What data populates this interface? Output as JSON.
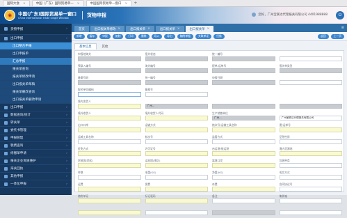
{
  "browser": {
    "tabs": [
      {
        "label": "国际大会",
        "active": false
      },
      {
        "label": "中国（广东）国际贸易单一",
        "active": false
      },
      {
        "label": "中国国际贸易单一窗口",
        "active": true
      }
    ]
  },
  "header": {
    "title": "中国(广东)国际贸易单一窗口",
    "subtitle": "China International Trade Single Window",
    "system_name": "货物申报",
    "user_text": "您好，广州宝联达代理报关有限公司 4401988888",
    "exit_icon": "power-icon"
  },
  "sidebar": {
    "items": [
      {
        "label": "货物申报",
        "level": 0,
        "top": true
      },
      {
        "label": "出口申报",
        "level": 1
      },
      {
        "label": "出口整合申报",
        "level": 2,
        "state": "selected"
      },
      {
        "label": "出口申报单",
        "level": 2
      },
      {
        "label": "汇总申报",
        "level": 2,
        "state": "selected2"
      },
      {
        "label": "报关单查询",
        "level": 2
      },
      {
        "label": "报关单修改申请",
        "level": 2
      },
      {
        "label": "出口报关单草稿",
        "level": 2
      },
      {
        "label": "报关单删改查询",
        "level": 2
      },
      {
        "label": "出口报关单删改申请",
        "level": 2
      },
      {
        "label": "出口申报",
        "level": 1
      },
      {
        "label": "数据查询/统计",
        "level": 1
      },
      {
        "label": "转关单",
        "level": 1
      },
      {
        "label": "委托书管理",
        "level": 1
      },
      {
        "label": "申报管理",
        "level": 1
      },
      {
        "label": "税费查询",
        "level": 1
      },
      {
        "label": "修撤单申请",
        "level": 1
      },
      {
        "label": "报关企业资质维护",
        "level": 1
      },
      {
        "label": "海关回执",
        "level": 1
      },
      {
        "label": "其他申报",
        "level": 1
      },
      {
        "label": "一体化申报",
        "level": 1
      }
    ]
  },
  "main": {
    "tabs": [
      {
        "label": "首页",
        "active": false
      },
      {
        "label": "出口报关单修改",
        "active": false
      },
      {
        "label": "出口报关单",
        "active": false
      },
      {
        "label": "出口报关单",
        "active": false
      },
      {
        "label": "出口报关单",
        "active": true
      }
    ],
    "toolbar": [
      "新增",
      "暂存",
      "申报",
      "复制",
      "打印",
      "删除",
      "导入",
      "导出",
      "随附单据",
      "关联单证",
      "扫描"
    ],
    "toolbar_right": [
      "返回",
      "上一页"
    ],
    "subtabs": [
      "基本信息",
      "其他"
    ],
    "fields": [
      {
        "label": "申报地海关",
        "value": "",
        "style": "grey"
      },
      {
        "label": "报关状态",
        "value": "",
        "style": "grey"
      },
      {
        "label": "统一编号",
        "value": "",
        "style": "grey"
      },
      {
        "label": "",
        "value": "",
        "style": "white"
      },
      {
        "label": "预录入编号",
        "value": "",
        "style": "grey"
      },
      {
        "label": "海关编号",
        "value": "",
        "style": "grey"
      },
      {
        "label": "提单/运单号",
        "value": "",
        "style": "grey"
      },
      {
        "label": "报关单类型",
        "value": "",
        "style": "grey"
      },
      {
        "label": "备案号码",
        "value": "",
        "style": "grey"
      },
      {
        "label": "统一编号",
        "value": "",
        "style": "grey"
      },
      {
        "label": "申报日期",
        "value": "",
        "style": "grey"
      },
      {
        "label": "",
        "value": "",
        "style": "white"
      },
      {
        "label": "报关单位编码",
        "value": "",
        "style": "blue"
      },
      {
        "label": "备案号",
        "value": "",
        "style": "white"
      },
      {
        "label": "",
        "value": "",
        "style": "none"
      },
      {
        "label": "",
        "value": "",
        "style": "none"
      },
      {
        "label": "境内发货人",
        "value": "",
        "style": "yellow"
      },
      {
        "label": "",
        "value": "广州...",
        "style": "grey"
      },
      {
        "label": "",
        "value": "",
        "style": "grey"
      },
      {
        "label": "",
        "value": "",
        "style": "grey"
      },
      {
        "label": "境外收货人",
        "value": "",
        "style": "yellow"
      },
      {
        "label": "境外收货人代码",
        "value": "",
        "style": "yellow"
      },
      {
        "label": "生产销售单位",
        "value": "广州...",
        "style": "grey"
      },
      {
        "label": "",
        "value": "广州宝联达代理报关有限公司",
        "style": "white"
      },
      {
        "label": "出口口岸",
        "value": "",
        "style": "yellow"
      },
      {
        "label": "运输方式",
        "value": "",
        "style": "yellow"
      },
      {
        "label": "航次号/运输工具名称",
        "value": "",
        "style": "yellow"
      },
      {
        "label": "提/运单号",
        "value": "",
        "style": "yellow"
      },
      {
        "label": "运输工具名称",
        "value": "",
        "style": "white"
      },
      {
        "label": "航次号",
        "value": "",
        "style": "white"
      },
      {
        "label": "监管方式",
        "value": "",
        "style": "white"
      },
      {
        "label": "征免性质",
        "value": "",
        "style": "white"
      },
      {
        "label": "征免方式",
        "value": "",
        "style": "yellow"
      },
      {
        "label": "许可证号",
        "value": "",
        "style": "yellow"
      },
      {
        "label": "启运港/指运港",
        "value": "",
        "style": "yellow"
      },
      {
        "label": "境内货源地",
        "value": "",
        "style": "yellow"
      },
      {
        "label": "贸易国(地区)",
        "value": "",
        "style": "yellow"
      },
      {
        "label": "运抵国(地区)",
        "value": "",
        "style": "yellow"
      },
      {
        "label": "离境口岸",
        "value": "",
        "style": "yellow"
      },
      {
        "label": "包装种类",
        "value": "",
        "style": "white"
      },
      {
        "label": "件数",
        "value": "",
        "style": "white"
      },
      {
        "label": "毛重(KG)",
        "value": "",
        "style": "white"
      },
      {
        "label": "净重(KG)",
        "value": "",
        "style": "white"
      },
      {
        "label": "成交方式",
        "value": "",
        "style": "white"
      },
      {
        "label": "运费",
        "value": "",
        "style": "yellow"
      },
      {
        "label": "保费",
        "value": "",
        "style": "yellow"
      },
      {
        "label": "杂费",
        "value": "",
        "style": "yellow"
      },
      {
        "label": "合同协议号",
        "value": "",
        "style": "white"
      },
      {
        "label": "随附单证",
        "value": "",
        "style": "yellow"
      },
      {
        "label": "标记唛码",
        "value": "",
        "style": "yellow"
      },
      {
        "label": "备注",
        "value": "",
        "style": "white"
      },
      {
        "label": "集装箱",
        "value": "",
        "style": "white"
      },
      {
        "label": "",
        "value": "",
        "style": "yellow"
      },
      {
        "label": "",
        "value": "",
        "style": "white"
      },
      {
        "label": "",
        "value": "",
        "style": "grey"
      },
      {
        "label": "",
        "value": "",
        "style": "white"
      }
    ]
  }
}
